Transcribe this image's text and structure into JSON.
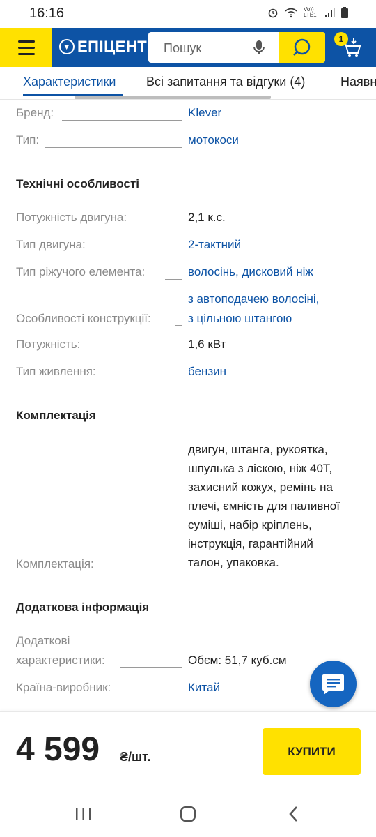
{
  "status_bar": {
    "time": "16:16",
    "network": "Vo)) LTE1"
  },
  "header": {
    "logo_text": "ЕПІЦЕНТР",
    "search_placeholder": "Пошук",
    "cart_count": "1",
    "brand_color": "#0d53a5",
    "accent_color": "#ffe100"
  },
  "tabs": [
    {
      "label": "Характеристики",
      "active": true
    },
    {
      "label": "Всі запитання та відгуки (4)",
      "active": false
    },
    {
      "label": "Наявн",
      "active": false
    }
  ],
  "specs": {
    "brand": {
      "label": "Бренд:",
      "value": "Klever"
    },
    "type": {
      "label": "Тип:",
      "value": "мотокоси"
    },
    "tech_section": "Технічні особливості",
    "engine_power": {
      "label": "Потужність двигуна:",
      "value": "2,1 к.с."
    },
    "engine_type": {
      "label": "Тип двигуна:",
      "value": "2-тактний"
    },
    "cutting_element": {
      "label": "Тип ріжучого елемента:",
      "value": "волосінь, дисковий ніж"
    },
    "design_features": {
      "label": "Особливості конструкції:",
      "value_line1": "з автоподачею волосіні,",
      "value_line2": "з цільною штангою"
    },
    "power": {
      "label": "Потужність:",
      "value": "1,6 кВт"
    },
    "power_supply": {
      "label": "Тип живлення:",
      "value": "бензин"
    },
    "kit_section": "Комплектація",
    "kit": {
      "label": "Комплектація:",
      "value_lines": [
        "двигун, штанга, рукоятка,",
        "шпулька з ліскою, ніж 40Т,",
        "захисний кожух, ремінь на",
        "плечі, ємність для паливної",
        "суміші, набір кріплень,",
        "інструкція, гарантійний",
        "талон, упаковка."
      ]
    },
    "extra_section": "Додаткова інформація",
    "extra": {
      "label_line1": "Додаткові",
      "label_line2": "характеристики:",
      "value": "Обєм: 51,7 куб.см"
    },
    "country": {
      "label": "Країна-виробник:",
      "value": "Китай"
    }
  },
  "purchase": {
    "price": "4 599",
    "currency": "₴/шт.",
    "buy_label": "КУПИТИ"
  }
}
